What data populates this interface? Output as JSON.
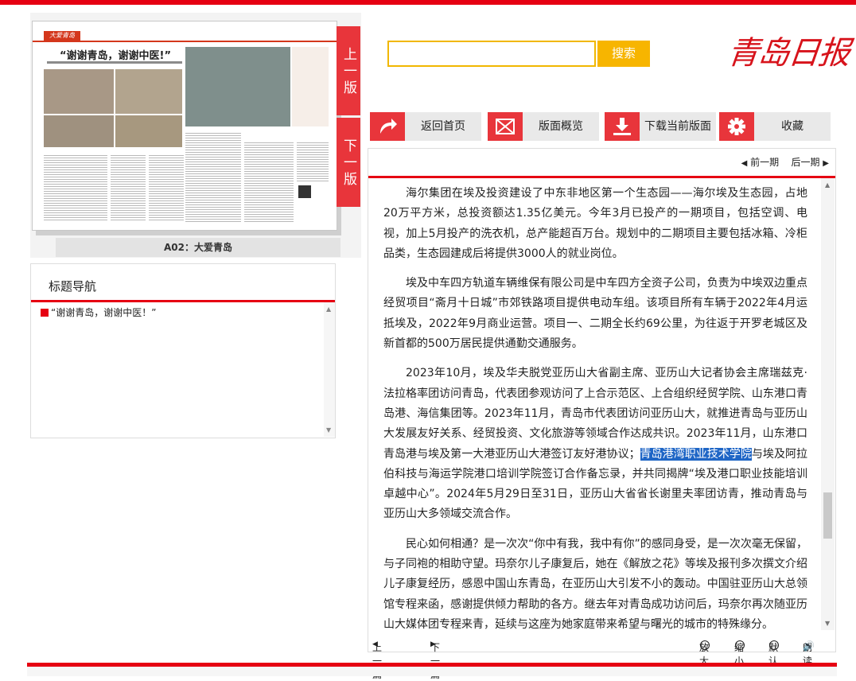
{
  "paper": {
    "logo_text": "大爱青岛",
    "headline": "“谢谢青岛，谢谢中医!”",
    "caption": "A02：大爱青岛"
  },
  "tabs": {
    "prev_label": "上一版",
    "next_label": "下一版"
  },
  "nav": {
    "title": "标题导航",
    "items": [
      "“谢谢青岛，谢谢中医！”"
    ]
  },
  "search": {
    "value": "",
    "button_label": "搜索"
  },
  "logo": "青岛日报",
  "toolbar": {
    "home_label": "返回首页",
    "overview_label": "版面概览",
    "download_label": "下载当前版面",
    "favorite_label": "收藏"
  },
  "period_nav": {
    "prev_label": "前一期",
    "next_label": "后一期"
  },
  "article": {
    "paragraphs": [
      "海尔集团在埃及投资建设了中东非地区第一个生态园——海尔埃及生态园，占地20万平方米，总投资额达1.35亿美元。今年3月已投产的一期项目，包括空调、电视，加上5月投产的洗衣机，总产能超百万台。规划中的二期项目主要包括冰箱、冷柜品类，生态园建成后将提供3000人的就业岗位。",
      "埃及中车四方轨道车辆维保有限公司是中车四方全资子公司，负责为中埃双边重点经贸项目“斋月十日城”市郊铁路项目提供电动车组。该项目所有车辆于2022年4月运抵埃及，2022年9月商业运营。项目一、二期全长约69公里，为往返于开罗老城区及新首都的500万居民提供通勤交通服务。",
      "民心如何相通？是一次次“你中有我，我中有你”的感同身受，是一次次毫无保留，与子同袍的相助守望。玛奈尔儿子康复后，她在《解放之花》等埃及报刊多次撰文介绍儿子康复经历，感恩中国山东青岛，在亚历山大引发不小的轰动。中国驻亚历山大总领馆专程来函，感谢提供倾力帮助的各方。继去年对青岛成功访问后，玛奈尔再次随亚历山大媒体团专程来青，延续与这座为她家庭带来希望与曙光的城市的特殊缘分。"
    ],
    "p3_before": "2023年10月，埃及华夫脱党亚历山大省副主席、亚历山大记者协会主席瑞兹克·法拉格率团访问青岛，代表团参观访问了上合示范区、上合组织经贸学院、山东港口青岛港、海信集团等。2023年11月，青岛市代表团访问亚历山大，就推进青岛与亚历山大发展友好关系、经贸投资、文化旅游等领域合作达成共识。2023年11月，山东港口青岛港与埃及第一大港亚历山大港签订友好港协议；",
    "p3_highlight": "青岛港湾职业技术学院",
    "p3_after": "与埃及阿拉伯科技与海运学院港口培训学院签订合作备忘录，并共同揭牌“埃及港口职业技能培训卓越中心”。2024年5月29日至31日，亚历山大省省长谢里夫率团访青，推动青岛与亚历山大多领域交流合作。"
  },
  "footer": {
    "prev_article": "上一篇",
    "next_article": "下一篇",
    "zoom_in": "放大",
    "zoom_out": "缩小",
    "default": "默认",
    "read": "朗读"
  },
  "colors": {
    "accent": "#e60012",
    "search": "#f7b500",
    "highlight": "#1f66c6"
  },
  "icons": [
    "share-arrow-icon",
    "envelope-icon",
    "download-icon",
    "gear-icon",
    "speaker-icon"
  ]
}
